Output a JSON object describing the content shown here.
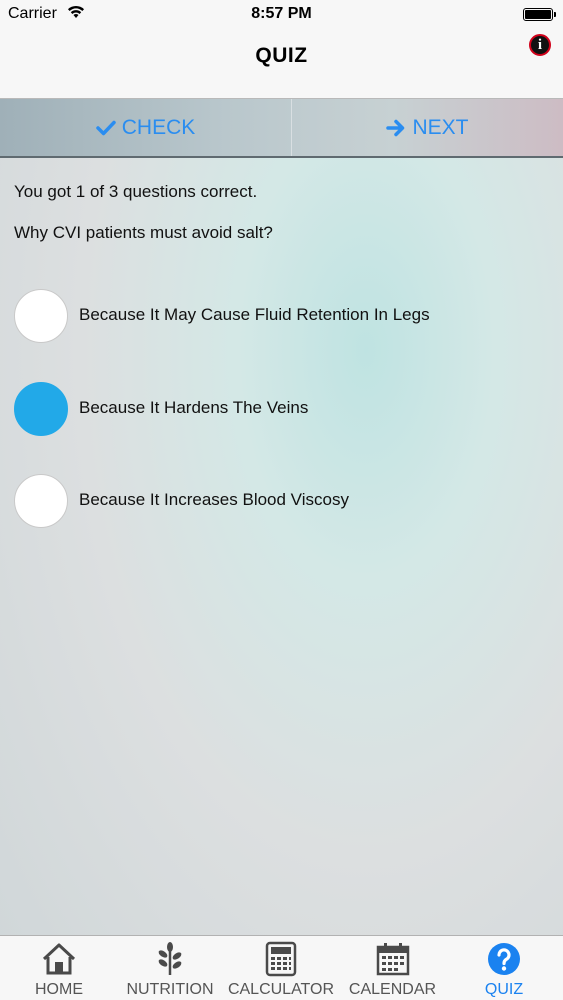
{
  "status_bar": {
    "carrier": "Carrier",
    "time": "8:57 PM",
    "icons": [
      "wifi-icon",
      "battery-icon"
    ]
  },
  "nav": {
    "title": "QUIZ",
    "info_icon": "info-icon"
  },
  "toolbar": {
    "check_label": "CHECK",
    "next_label": "NEXT",
    "check_icon": "checkmark-icon",
    "next_icon": "arrow-right-icon",
    "accent": "#2a8df0"
  },
  "quiz": {
    "score_text": "You got 1 of 3 questions correct.",
    "question": "Why CVI patients must avoid salt?",
    "options": [
      {
        "label": "Because It May Cause Fluid Retention In Legs",
        "selected": false
      },
      {
        "label": "Because It Hardens The Veins",
        "selected": true
      },
      {
        "label": "Because It Increases Blood Viscosy",
        "selected": false
      }
    ],
    "selected_color": "#22a9e8"
  },
  "tabbar": {
    "tabs": [
      {
        "label": "HOME",
        "icon": "home-icon",
        "active": false
      },
      {
        "label": "NUTRITION",
        "icon": "leaf-icon",
        "active": false
      },
      {
        "label": "CALCULATOR",
        "icon": "calculator-icon",
        "active": false
      },
      {
        "label": "CALENDAR",
        "icon": "calendar-icon",
        "active": false
      },
      {
        "label": "QUIZ",
        "icon": "question-icon",
        "active": true
      }
    ],
    "active_color": "#1a82f0"
  }
}
